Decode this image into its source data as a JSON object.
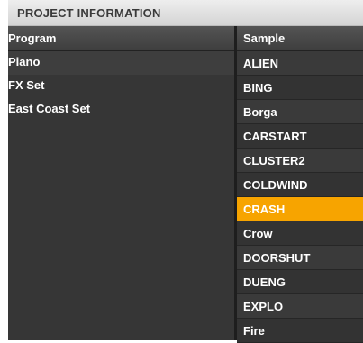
{
  "panel_title": "PROJECT INFORMATION",
  "program_column": {
    "header": "Program",
    "items": [
      "Piano",
      "FX Set",
      "East Coast Set"
    ]
  },
  "sample_column": {
    "header": "Sample",
    "items": [
      "ALIEN",
      "BING",
      "Borga",
      "CARSTART",
      "CLUSTER2",
      "COLDWIND",
      "CRASH",
      "Crow",
      "DOORSHUT",
      "DUENG",
      "EXPLO",
      "Fire"
    ],
    "selected": "CRASH"
  },
  "colors": {
    "accent_selected": "#f7a400",
    "panel_background": "#2f2f2f",
    "title_bar": "#e2e2e2"
  }
}
